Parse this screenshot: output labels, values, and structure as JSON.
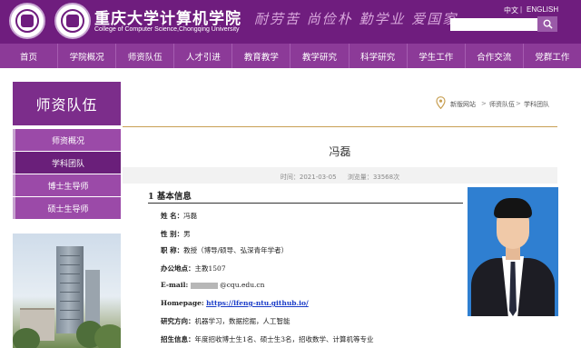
{
  "header": {
    "brand_cn": "重庆大学计算机学院",
    "brand_en": "College of Computer Science,Chongqing University",
    "motto": "耐劳苦 尚俭朴 勤学业 爱国家",
    "lang_cn": "中文",
    "lang_sep": "|",
    "lang_en": "ENGLISH",
    "search_value": ""
  },
  "nav": {
    "items": [
      "首页",
      "学院概况",
      "师资队伍",
      "人才引进",
      "教育教学",
      "教学研究",
      "科学研究",
      "学生工作",
      "合作交流",
      "党群工作"
    ]
  },
  "sidebar": {
    "title": "师资队伍",
    "items": [
      "师资概况",
      "学科团队",
      "博士生导师",
      "硕士生导师"
    ],
    "active_index": 1
  },
  "breadcrumb": {
    "items": [
      "新版网站",
      "师资队伍",
      "学科团队"
    ],
    "separator": ">"
  },
  "article": {
    "title": "冯磊",
    "time_label": "时间：",
    "time": "2021-03-05",
    "views_label": "浏览量：",
    "views": "33568次",
    "section_heading": "1 基本信息",
    "rows": {
      "name": {
        "label": "姓 名：",
        "value": "冯磊"
      },
      "gender": {
        "label": "性 别：",
        "value": "男"
      },
      "title": {
        "label": "职 称：",
        "value": "教授（博导/硕导、弘深青年学者）"
      },
      "office": {
        "label": "办公地点：",
        "value": "主教1507"
      },
      "email": {
        "label": "E-mail:",
        "value": "@cqu.edu.cn"
      },
      "homepage": {
        "label": "Homepage:",
        "value": "https://lfeng-ntu.github.io/"
      },
      "research": {
        "label": "研究方向：",
        "value": "机器学习，数据挖掘，人工智能"
      },
      "enrollment": {
        "label": "招生信息：",
        "value": "年度招收博士生1名、硕士生3名，招收数学、计算机等专业"
      }
    }
  },
  "colors": {
    "brand_purple": "#6f1d7e",
    "nav_purple": "#8c3a98",
    "accent_gold": "#c8a054",
    "link_blue": "#1a3cc8",
    "portrait_bg": "#2f7fd1"
  },
  "icons": {
    "search": "search-icon",
    "location": "location-pin-icon"
  }
}
